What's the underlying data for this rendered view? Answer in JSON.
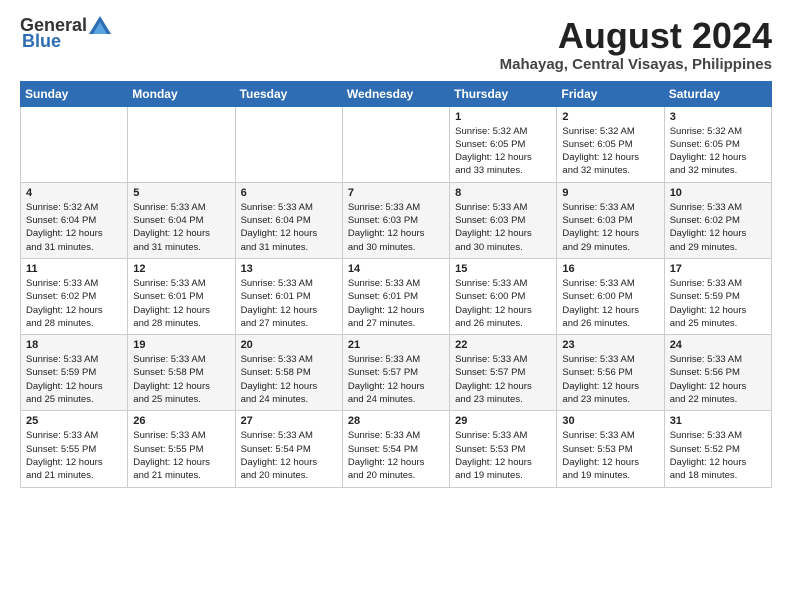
{
  "header": {
    "logo_general": "General",
    "logo_blue": "Blue",
    "main_title": "August 2024",
    "subtitle": "Mahayag, Central Visayas, Philippines"
  },
  "columns": [
    "Sunday",
    "Monday",
    "Tuesday",
    "Wednesday",
    "Thursday",
    "Friday",
    "Saturday"
  ],
  "weeks": [
    [
      {
        "day": "",
        "info": ""
      },
      {
        "day": "",
        "info": ""
      },
      {
        "day": "",
        "info": ""
      },
      {
        "day": "",
        "info": ""
      },
      {
        "day": "1",
        "info": "Sunrise: 5:32 AM\nSunset: 6:05 PM\nDaylight: 12 hours\nand 33 minutes."
      },
      {
        "day": "2",
        "info": "Sunrise: 5:32 AM\nSunset: 6:05 PM\nDaylight: 12 hours\nand 32 minutes."
      },
      {
        "day": "3",
        "info": "Sunrise: 5:32 AM\nSunset: 6:05 PM\nDaylight: 12 hours\nand 32 minutes."
      }
    ],
    [
      {
        "day": "4",
        "info": "Sunrise: 5:32 AM\nSunset: 6:04 PM\nDaylight: 12 hours\nand 31 minutes."
      },
      {
        "day": "5",
        "info": "Sunrise: 5:33 AM\nSunset: 6:04 PM\nDaylight: 12 hours\nand 31 minutes."
      },
      {
        "day": "6",
        "info": "Sunrise: 5:33 AM\nSunset: 6:04 PM\nDaylight: 12 hours\nand 31 minutes."
      },
      {
        "day": "7",
        "info": "Sunrise: 5:33 AM\nSunset: 6:03 PM\nDaylight: 12 hours\nand 30 minutes."
      },
      {
        "day": "8",
        "info": "Sunrise: 5:33 AM\nSunset: 6:03 PM\nDaylight: 12 hours\nand 30 minutes."
      },
      {
        "day": "9",
        "info": "Sunrise: 5:33 AM\nSunset: 6:03 PM\nDaylight: 12 hours\nand 29 minutes."
      },
      {
        "day": "10",
        "info": "Sunrise: 5:33 AM\nSunset: 6:02 PM\nDaylight: 12 hours\nand 29 minutes."
      }
    ],
    [
      {
        "day": "11",
        "info": "Sunrise: 5:33 AM\nSunset: 6:02 PM\nDaylight: 12 hours\nand 28 minutes."
      },
      {
        "day": "12",
        "info": "Sunrise: 5:33 AM\nSunset: 6:01 PM\nDaylight: 12 hours\nand 28 minutes."
      },
      {
        "day": "13",
        "info": "Sunrise: 5:33 AM\nSunset: 6:01 PM\nDaylight: 12 hours\nand 27 minutes."
      },
      {
        "day": "14",
        "info": "Sunrise: 5:33 AM\nSunset: 6:01 PM\nDaylight: 12 hours\nand 27 minutes."
      },
      {
        "day": "15",
        "info": "Sunrise: 5:33 AM\nSunset: 6:00 PM\nDaylight: 12 hours\nand 26 minutes."
      },
      {
        "day": "16",
        "info": "Sunrise: 5:33 AM\nSunset: 6:00 PM\nDaylight: 12 hours\nand 26 minutes."
      },
      {
        "day": "17",
        "info": "Sunrise: 5:33 AM\nSunset: 5:59 PM\nDaylight: 12 hours\nand 25 minutes."
      }
    ],
    [
      {
        "day": "18",
        "info": "Sunrise: 5:33 AM\nSunset: 5:59 PM\nDaylight: 12 hours\nand 25 minutes."
      },
      {
        "day": "19",
        "info": "Sunrise: 5:33 AM\nSunset: 5:58 PM\nDaylight: 12 hours\nand 25 minutes."
      },
      {
        "day": "20",
        "info": "Sunrise: 5:33 AM\nSunset: 5:58 PM\nDaylight: 12 hours\nand 24 minutes."
      },
      {
        "day": "21",
        "info": "Sunrise: 5:33 AM\nSunset: 5:57 PM\nDaylight: 12 hours\nand 24 minutes."
      },
      {
        "day": "22",
        "info": "Sunrise: 5:33 AM\nSunset: 5:57 PM\nDaylight: 12 hours\nand 23 minutes."
      },
      {
        "day": "23",
        "info": "Sunrise: 5:33 AM\nSunset: 5:56 PM\nDaylight: 12 hours\nand 23 minutes."
      },
      {
        "day": "24",
        "info": "Sunrise: 5:33 AM\nSunset: 5:56 PM\nDaylight: 12 hours\nand 22 minutes."
      }
    ],
    [
      {
        "day": "25",
        "info": "Sunrise: 5:33 AM\nSunset: 5:55 PM\nDaylight: 12 hours\nand 21 minutes."
      },
      {
        "day": "26",
        "info": "Sunrise: 5:33 AM\nSunset: 5:55 PM\nDaylight: 12 hours\nand 21 minutes."
      },
      {
        "day": "27",
        "info": "Sunrise: 5:33 AM\nSunset: 5:54 PM\nDaylight: 12 hours\nand 20 minutes."
      },
      {
        "day": "28",
        "info": "Sunrise: 5:33 AM\nSunset: 5:54 PM\nDaylight: 12 hours\nand 20 minutes."
      },
      {
        "day": "29",
        "info": "Sunrise: 5:33 AM\nSunset: 5:53 PM\nDaylight: 12 hours\nand 19 minutes."
      },
      {
        "day": "30",
        "info": "Sunrise: 5:33 AM\nSunset: 5:53 PM\nDaylight: 12 hours\nand 19 minutes."
      },
      {
        "day": "31",
        "info": "Sunrise: 5:33 AM\nSunset: 5:52 PM\nDaylight: 12 hours\nand 18 minutes."
      }
    ]
  ]
}
